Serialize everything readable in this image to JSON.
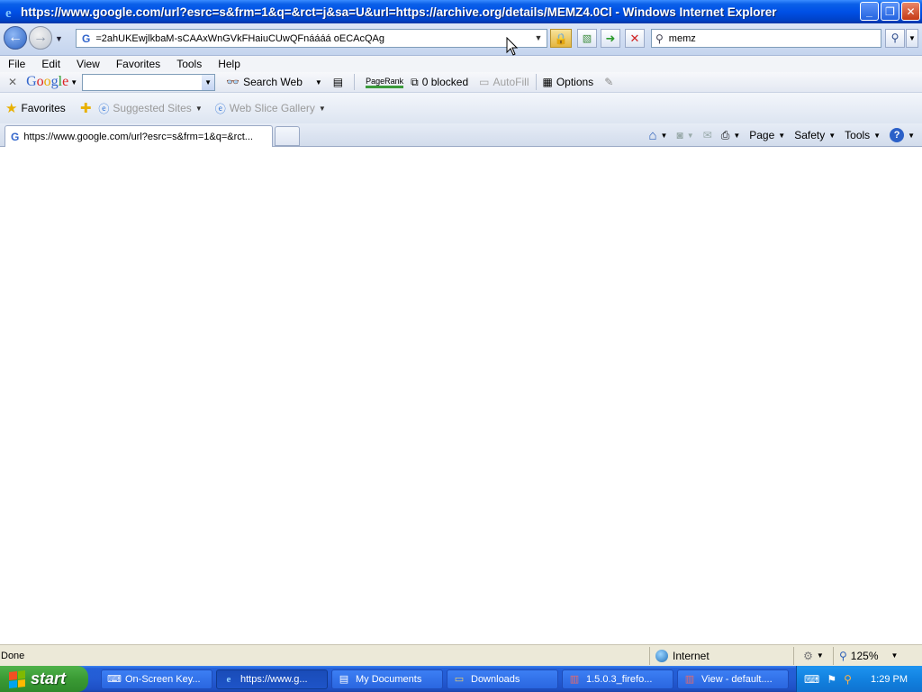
{
  "window": {
    "title": "https://www.google.com/url?esrc=s&frm=1&q=&rct=j&sa=U&url=https://archive.org/details/MEMZ4.0Cl - Windows Internet Explorer",
    "minimize": "_",
    "maximize": "❐",
    "close": "✕"
  },
  "address_bar": {
    "favicon": "G",
    "url": "=2ahUKEwjlkbaM-sCAAxWnGVkFHaiuCUwQFnáááá oECAcQAg"
  },
  "search_box": {
    "query": "memz"
  },
  "menu": [
    "File",
    "Edit",
    "View",
    "Favorites",
    "Tools",
    "Help"
  ],
  "google_toolbar": {
    "logo": "Google",
    "search_web": "Search Web",
    "pagerank": "PageRank",
    "blocked": "0 blocked",
    "autofill": "AutoFill",
    "options": "Options"
  },
  "favorites_bar": {
    "favorites": "Favorites",
    "suggested_sites": "Suggested Sites",
    "web_slice_gallery": "Web Slice Gallery"
  },
  "tab": {
    "favicon": "G",
    "title": "https://www.google.com/url?esrc=s&frm=1&q=&rct..."
  },
  "command_bar": {
    "page": "Page",
    "safety": "Safety",
    "tools": "Tools",
    "help": "?"
  },
  "status_bar": {
    "status": "Done",
    "zone": "Internet",
    "zoom": "125%"
  },
  "taskbar": {
    "start": "start",
    "tasks": [
      {
        "label": "On-Screen Key...",
        "icon": "keyboard-icon"
      },
      {
        "label": "https://www.g...",
        "icon": "ie-icon",
        "active": true
      },
      {
        "label": "My Documents",
        "icon": "folder-icon"
      },
      {
        "label": "Downloads",
        "icon": "folder-icon"
      },
      {
        "label": "1.5.0.3_firefo...",
        "icon": "archive-icon"
      },
      {
        "label": "View - default....",
        "icon": "archive-icon"
      }
    ],
    "clock": "1:29 PM"
  },
  "colors": {
    "title_bar": "#0050E6",
    "taskbar": "#245CD4",
    "start": "#3A9A34",
    "tray": "#1282E0"
  }
}
